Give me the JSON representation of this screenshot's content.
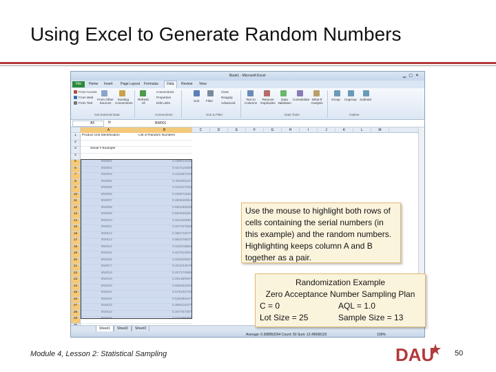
{
  "slide": {
    "title": "Using Excel to Generate Random Numbers",
    "footer": "Module 4, Lesson 2: Statistical Sampling",
    "page_number": "50",
    "logo_text": "DAU",
    "accent_color": "#b23a3a"
  },
  "excel": {
    "window_title": "Book1 - Microsoft Excel",
    "tabs": [
      "File",
      "Home",
      "Insert",
      "Page Layout",
      "Formulas",
      "Data",
      "Review",
      "View"
    ],
    "active_tab": "Data",
    "ribbon_items": [
      "From Access",
      "From Web",
      "From Text",
      "From Other Sources",
      "Existing Connections",
      "Refresh All",
      "Connections",
      "Properties",
      "Edit Links",
      "Sort",
      "Filter",
      "Clear",
      "Reapply",
      "Advanced",
      "Text to Columns",
      "Remove Duplicates",
      "Data Validation",
      "Consolidate",
      "What-If Analysis",
      "Group",
      "Ungroup",
      "Subtotal"
    ],
    "ribbon_groups": [
      "Get External Data",
      "Connections",
      "Sort & Filter",
      "Data Tools",
      "Outline"
    ],
    "name_box": "A5",
    "fx_label": "fx",
    "formula_value": "BW001",
    "columns": [
      "A",
      "B",
      "C",
      "D",
      "E",
      "F",
      "G",
      "H",
      "I",
      "J",
      "K",
      "L",
      "M"
    ],
    "header_row": {
      "a": "Product Unit Identification",
      "b": "List of Random Numbers"
    },
    "example_label": "Serial # Example",
    "rows": [
      {
        "n": "1",
        "a": "Product Unit Identification",
        "b": "List of Random Numbers"
      },
      {
        "n": "2",
        "a": "",
        "b": ""
      },
      {
        "n": "3",
        "a": "Serial # Example",
        "b": ""
      },
      {
        "n": "4",
        "a": "",
        "b": ""
      },
      {
        "n": "5",
        "a": "BW001",
        "b": "0.189513132"
      },
      {
        "n": "6",
        "a": "BW002",
        "b": "0.517110058"
      },
      {
        "n": "7",
        "a": "BW003",
        "b": "0.133387418"
      },
      {
        "n": "8",
        "a": "BW004",
        "b": "0.363391121"
      },
      {
        "n": "9",
        "a": "BW005",
        "b": "0.342147316"
      },
      {
        "n": "10",
        "a": "BW006",
        "b": "0.200671561"
      },
      {
        "n": "11",
        "a": "BW007",
        "b": "0.383640954"
      },
      {
        "n": "12",
        "a": "BW008",
        "b": "0.585186538"
      },
      {
        "n": "13",
        "a": "BW009",
        "b": "0.584036451"
      },
      {
        "n": "14",
        "a": "BW010",
        "b": "0.342340951"
      },
      {
        "n": "15",
        "a": "BW011",
        "b": "0.407107926"
      },
      {
        "n": "16",
        "a": "BW012",
        "b": "0.390716277"
      },
      {
        "n": "17",
        "a": "BW013",
        "b": "0.982478637"
      },
      {
        "n": "18",
        "a": "BW014",
        "b": "0.192019664"
      },
      {
        "n": "19",
        "a": "BW015",
        "b": "0.407913004"
      },
      {
        "n": "20",
        "a": "BW016",
        "b": "0.349128937"
      },
      {
        "n": "21",
        "a": "BW017",
        "b": "0.404134679"
      },
      {
        "n": "22",
        "a": "BW018",
        "b": "0.407170886"
      },
      {
        "n": "23",
        "a": "BW019",
        "b": "0.281489487"
      },
      {
        "n": "24",
        "a": "BW020",
        "b": "0.586492032"
      },
      {
        "n": "25",
        "a": "BW021",
        "b": "0.575132715"
      },
      {
        "n": "26",
        "a": "BW022",
        "b": "0.536396427"
      },
      {
        "n": "27",
        "a": "BW023",
        "b": "0.366415377"
      },
      {
        "n": "28",
        "a": "BW024",
        "b": "0.307757397"
      },
      {
        "n": "29",
        "a": "BW025",
        "b": "0.277769387"
      },
      {
        "n": "30",
        "a": "",
        "b": ""
      }
    ],
    "sheet_tabs": [
      "Sheet1",
      "Sheet2",
      "Sheet3"
    ],
    "status": "Average: 0.398853264    Count: 50    Sum: 12.49698126",
    "zoom": "100%"
  },
  "callout1": {
    "text": "Use the mouse to highlight both rows of cells containing the serial numbers (in this example) and the random numbers. Highlighting keeps column A and B together as a pair."
  },
  "callout2": {
    "line1": "Randomization Example",
    "line2": "Zero Acceptance Number Sampling Plan",
    "c": "C = 0",
    "aql": "AQL = 1.0",
    "lot": "Lot Size = 25",
    "sample": "Sample Size = 13"
  }
}
